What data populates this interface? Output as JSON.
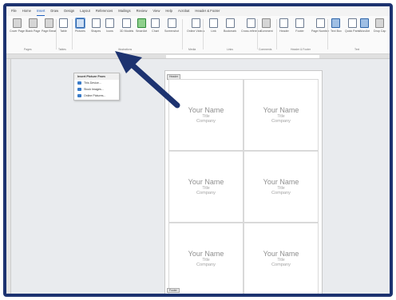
{
  "menu_tabs": [
    {
      "label": "File",
      "active": false
    },
    {
      "label": "Home",
      "active": false
    },
    {
      "label": "Insert",
      "active": true
    },
    {
      "label": "Draw",
      "active": false
    },
    {
      "label": "Design",
      "active": false
    },
    {
      "label": "Layout",
      "active": false
    },
    {
      "label": "References",
      "active": false
    },
    {
      "label": "Mailings",
      "active": false
    },
    {
      "label": "Review",
      "active": false
    },
    {
      "label": "View",
      "active": false
    },
    {
      "label": "Help",
      "active": false
    },
    {
      "label": "Acrobat",
      "active": false
    },
    {
      "label": "Header & Footer",
      "active": false
    }
  ],
  "ribbon": {
    "buttons": [
      {
        "label": "Cover Page",
        "icon": "cover-page-icon",
        "style": "gray"
      },
      {
        "label": "Blank Page",
        "icon": "blank-page-icon",
        "style": "gray"
      },
      {
        "label": "Page Break",
        "icon": "page-break-icon",
        "style": "gray"
      },
      {
        "label": "Table",
        "icon": "table-icon",
        "style": "plain"
      },
      {
        "label": "Pictures",
        "icon": "pictures-icon",
        "style": "blue"
      },
      {
        "label": "Shapes",
        "icon": "shapes-icon",
        "style": "plain"
      },
      {
        "label": "Icons",
        "icon": "icons-icon",
        "style": "plain"
      },
      {
        "label": "3D Models",
        "icon": "3d-models-icon",
        "style": "plain"
      },
      {
        "label": "SmartArt",
        "icon": "smartart-icon",
        "style": "green"
      },
      {
        "label": "Chart",
        "icon": "chart-icon",
        "style": "plain"
      },
      {
        "label": "Screenshot",
        "icon": "screenshot-icon",
        "style": "plain"
      },
      {
        "label": "Online Videos",
        "icon": "online-videos-icon",
        "style": "plain"
      },
      {
        "label": "Link",
        "icon": "link-icon",
        "style": "plain"
      },
      {
        "label": "Bookmark",
        "icon": "bookmark-icon",
        "style": "plain"
      },
      {
        "label": "Cross-reference",
        "icon": "cross-reference-icon",
        "style": "plain"
      },
      {
        "label": "Comment",
        "icon": "comment-icon",
        "style": "gray"
      },
      {
        "label": "Header",
        "icon": "header-icon",
        "style": "plain"
      },
      {
        "label": "Footer",
        "icon": "footer-icon",
        "style": "plain"
      },
      {
        "label": "Page Number",
        "icon": "page-number-icon",
        "style": "plain"
      },
      {
        "label": "Text Box",
        "icon": "text-box-icon",
        "style": "blue"
      },
      {
        "label": "Quick Parts",
        "icon": "quick-parts-icon",
        "style": "plain"
      },
      {
        "label": "WordArt",
        "icon": "wordart-icon",
        "style": "blue"
      },
      {
        "label": "Drop Cap",
        "icon": "drop-cap-icon",
        "style": "gray"
      }
    ],
    "groups": [
      {
        "label": "Pages"
      },
      {
        "label": "Tables"
      },
      {
        "label": "Illustrations"
      },
      {
        "label": "Media"
      },
      {
        "label": "Links"
      },
      {
        "label": "Comments"
      },
      {
        "label": "Header & Footer"
      },
      {
        "label": "Text"
      }
    ]
  },
  "dropdown": {
    "title": "Insert Picture From",
    "items": [
      {
        "label": "This Device..."
      },
      {
        "label": "Stock Images..."
      },
      {
        "label": "Online Pictures..."
      }
    ]
  },
  "document": {
    "header_tag": "Header",
    "footer_tag": "Footer",
    "cards": [
      {
        "name": "Your Name",
        "title": "Title",
        "company": "Company"
      },
      {
        "name": "Your Name",
        "title": "Title",
        "company": "Company"
      },
      {
        "name": "Your Name",
        "title": "Title",
        "company": "Company"
      },
      {
        "name": "Your Name",
        "title": "Title",
        "company": "Company"
      },
      {
        "name": "Your Name",
        "title": "Title",
        "company": "Company"
      },
      {
        "name": "Your Name",
        "title": "Title",
        "company": "Company"
      }
    ]
  },
  "colors": {
    "frame": "#1d3370",
    "arrow": "#1d3370",
    "accent": "#1f5fbf"
  }
}
